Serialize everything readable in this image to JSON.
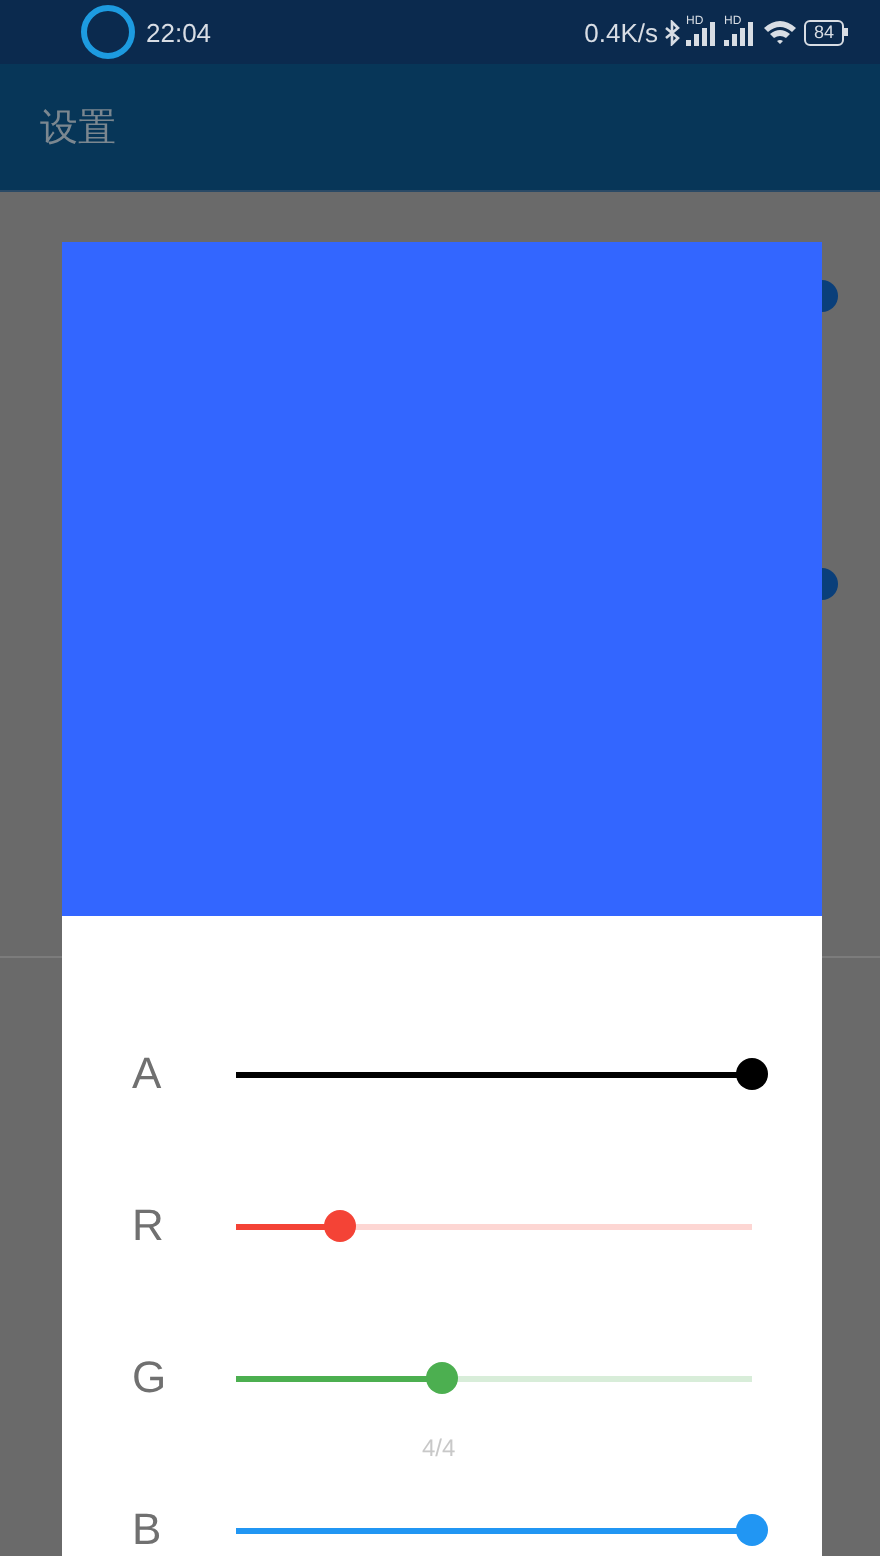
{
  "status_bar": {
    "time": "22:04",
    "speed": "0.4K/s",
    "signal_labels": [
      "HD",
      "HD"
    ],
    "battery": "84"
  },
  "app_bar": {
    "title": "设置"
  },
  "background_switches": [
    {
      "on": true
    },
    {
      "on": true
    }
  ],
  "color_dialog": {
    "page_indicator": "4/4",
    "sliders": [
      {
        "label": "A",
        "color": "#000000",
        "level": 1.0
      },
      {
        "label": "R",
        "color": "#f44336",
        "level": 0.2
      },
      {
        "label": "G",
        "color": "#4caf50",
        "level": 0.4
      },
      {
        "label": "B",
        "color": "#2196f3",
        "level": 1.0
      }
    ]
  }
}
